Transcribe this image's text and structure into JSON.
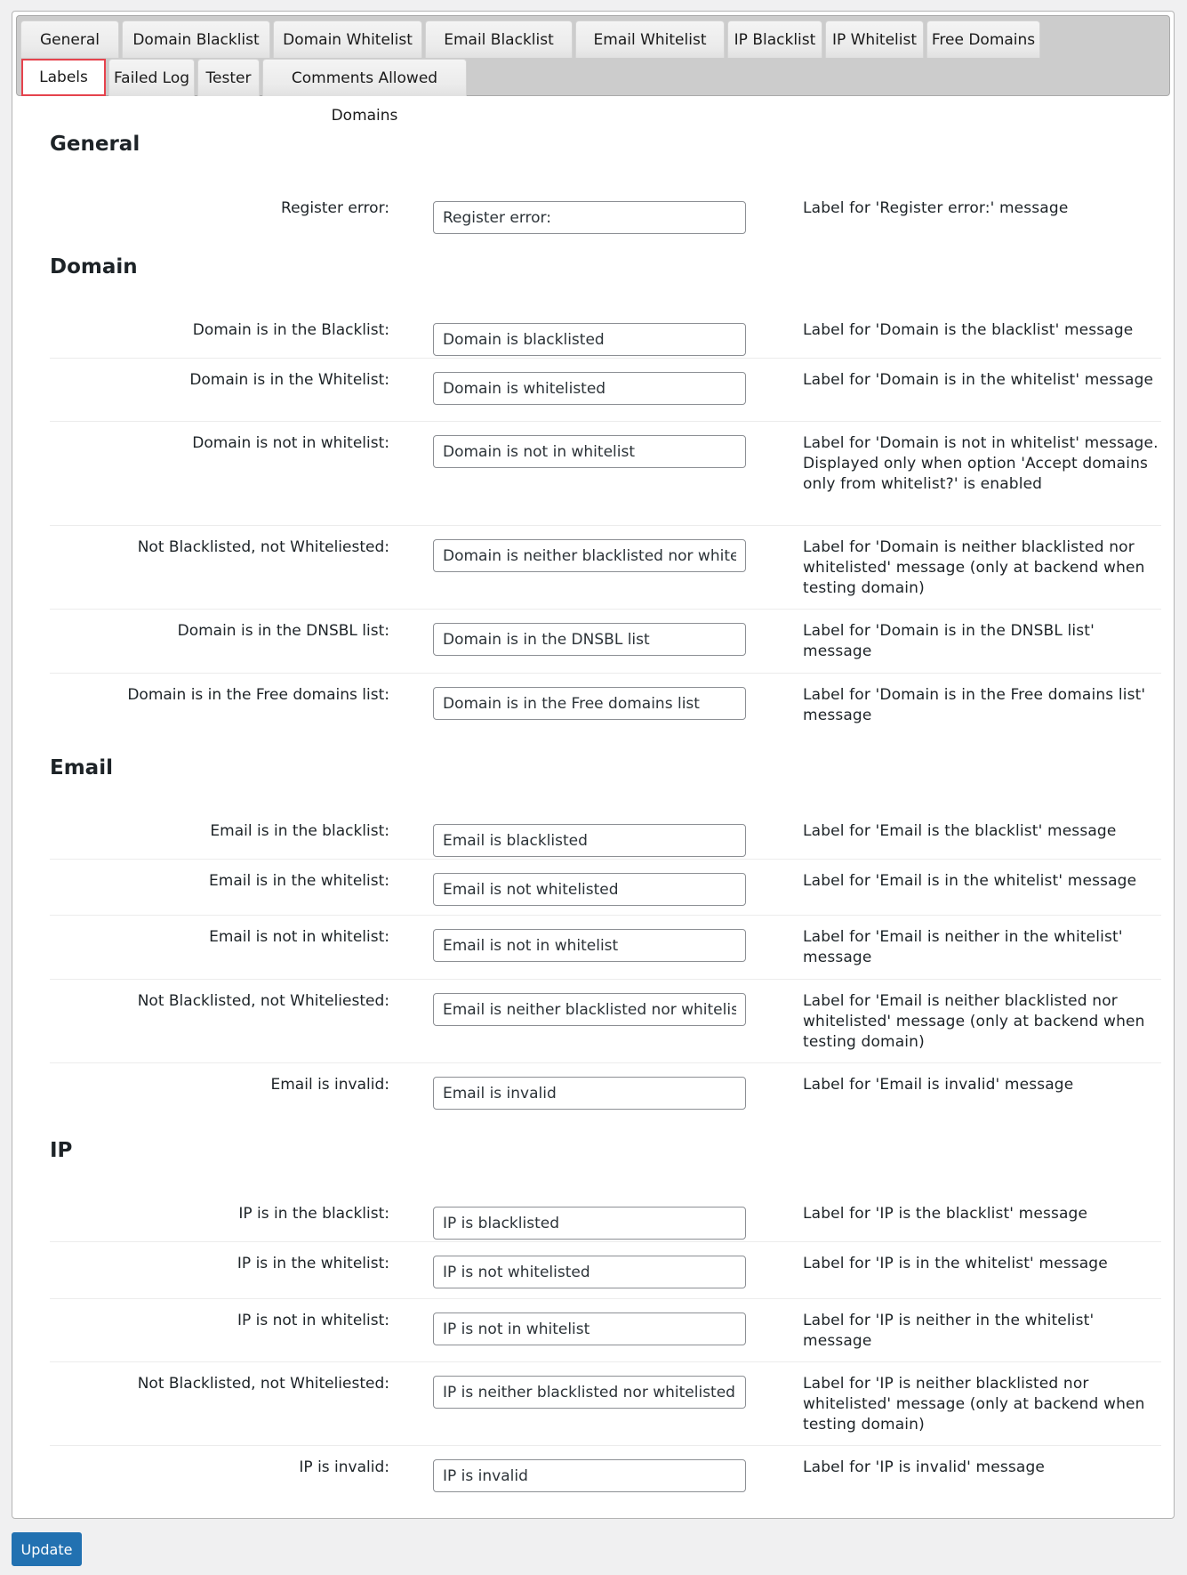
{
  "tabs": [
    {
      "label": "General",
      "active": false
    },
    {
      "label": "Domain Blacklist",
      "active": false
    },
    {
      "label": "Domain Whitelist",
      "active": false
    },
    {
      "label": "Email Blacklist",
      "active": false
    },
    {
      "label": "Email Whitelist",
      "active": false
    },
    {
      "label": "IP Blacklist",
      "active": false
    },
    {
      "label": "IP Whitelist",
      "active": false
    },
    {
      "label": "Free Domains",
      "active": false
    },
    {
      "label": "Labels",
      "active": true
    },
    {
      "label": "Failed Log",
      "active": false
    },
    {
      "label": "Tester",
      "active": false
    },
    {
      "label": "Comments Allowed Domains",
      "active": false
    }
  ],
  "sections": [
    {
      "title": "General",
      "rows": [
        {
          "label": "Register error:",
          "value": "Register error:",
          "description": "Label for 'Register error:' message"
        }
      ]
    },
    {
      "title": "Domain",
      "rows": [
        {
          "label": "Domain is in the Blacklist:",
          "value": "Domain is blacklisted",
          "description": "Label for 'Domain is the blacklist' message"
        },
        {
          "label": "Domain is in the Whitelist:",
          "value": "Domain is whitelisted",
          "description": "Label for 'Domain is in the whitelist' message"
        },
        {
          "label": "Domain is not in whitelist:",
          "value": "Domain is not in whitelist",
          "description": "Label for 'Domain is not in whitelist' message. Displayed only when option 'Accept domains only from whitelist?' is enabled"
        },
        {
          "label": "Not Blacklisted, not Whiteliested:",
          "value": "Domain is neither blacklisted nor whitelisted",
          "description": "Label for 'Domain is neither blacklisted nor whitelisted' message (only at backend when testing domain)"
        },
        {
          "label": "Domain is in the DNSBL list:",
          "value": "Domain is in the DNSBL list",
          "description": "Label for 'Domain is in the DNSBL list' message"
        },
        {
          "label": "Domain is in the Free domains list:",
          "value": "Domain is in the Free domains list",
          "description": "Label for 'Domain is in the Free domains list' message"
        }
      ]
    },
    {
      "title": "Email",
      "rows": [
        {
          "label": "Email is in the blacklist:",
          "value": "Email is blacklisted",
          "description": "Label for 'Email is the blacklist' message"
        },
        {
          "label": "Email is in the whitelist:",
          "value": "Email is not whitelisted",
          "description": "Label for 'Email is in the whitelist' message"
        },
        {
          "label": "Email is not in whitelist:",
          "value": "Email is not in whitelist",
          "description": "Label for 'Email is neither in the whitelist' message"
        },
        {
          "label": "Not Blacklisted, not Whiteliested:",
          "value": "Email is neither blacklisted nor whitelisted",
          "description": "Label for 'Email is neither blacklisted nor whitelisted' message (only at backend when testing domain)"
        },
        {
          "label": "Email is invalid:",
          "value": "Email is invalid",
          "description": "Label for 'Email is invalid' message"
        }
      ]
    },
    {
      "title": "IP",
      "rows": [
        {
          "label": "IP is in the blacklist:",
          "value": "IP is blacklisted",
          "description": "Label for 'IP is the blacklist' message"
        },
        {
          "label": "IP is in the whitelist:",
          "value": "IP is not whitelisted",
          "description": "Label for 'IP is in the whitelist' message"
        },
        {
          "label": "IP is not in whitelist:",
          "value": "IP is not in whitelist",
          "description": "Label for 'IP is neither in the whitelist' message"
        },
        {
          "label": "Not Blacklisted, not Whiteliested:",
          "value": "IP is neither blacklisted nor whitelisted",
          "description": "Label for 'IP is neither blacklisted nor whitelisted' message (only at backend when testing domain)"
        },
        {
          "label": "IP is invalid:",
          "value": "IP is invalid",
          "description": "Label for 'IP is invalid' message"
        }
      ]
    }
  ],
  "update_button": "Update",
  "colors": {
    "accent": "#2271b1",
    "active_tab_outline": "#e5434d"
  }
}
